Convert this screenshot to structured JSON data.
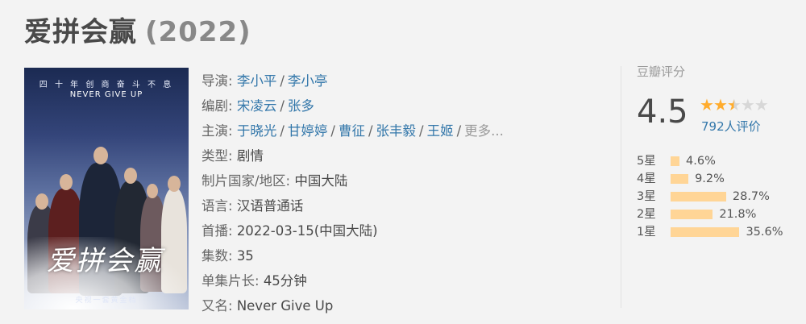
{
  "title": {
    "name": "爱拼会赢",
    "year": "(2022)"
  },
  "poster": {
    "slogan_cn": "四 十 年 创 商 奋 斗 不 息",
    "slogan_en": "NEVER GIVE UP",
    "calligraphy": "爱拼会赢",
    "caption": "央视一套黄金档"
  },
  "info": {
    "director": {
      "label": "导演:",
      "names": [
        "李小平",
        "李小亭"
      ]
    },
    "writer": {
      "label": "编剧:",
      "names": [
        "宋凌云",
        "张多"
      ]
    },
    "cast": {
      "label": "主演:",
      "names": [
        "于晓光",
        "甘婷婷",
        "曹征",
        "张丰毅",
        "王姬"
      ],
      "more": "更多..."
    },
    "genre": {
      "label": "类型:",
      "value": "剧情"
    },
    "country": {
      "label": "制片国家/地区:",
      "value": "中国大陆"
    },
    "language": {
      "label": "语言:",
      "value": "汉语普通话"
    },
    "premiere": {
      "label": "首播:",
      "value": "2022-03-15(中国大陆)"
    },
    "episodes": {
      "label": "集数:",
      "value": "35"
    },
    "runtime": {
      "label": "单集片长:",
      "value": "45分钟"
    },
    "aka": {
      "label": "又名:",
      "value": "Never Give Up"
    }
  },
  "rating": {
    "header": "豆瓣评分",
    "score": "4.5",
    "stars_value": 2.5,
    "count": "792人评价",
    "accent_color": "#ffac2d",
    "bar_color": "#ffd596",
    "distribution": [
      {
        "label": "5星",
        "pct": "4.6%",
        "value": 4.6
      },
      {
        "label": "4星",
        "pct": "9.2%",
        "value": 9.2
      },
      {
        "label": "3星",
        "pct": "28.7%",
        "value": 28.7
      },
      {
        "label": "2星",
        "pct": "21.8%",
        "value": 21.8
      },
      {
        "label": "1星",
        "pct": "35.6%",
        "value": 35.6
      }
    ]
  }
}
